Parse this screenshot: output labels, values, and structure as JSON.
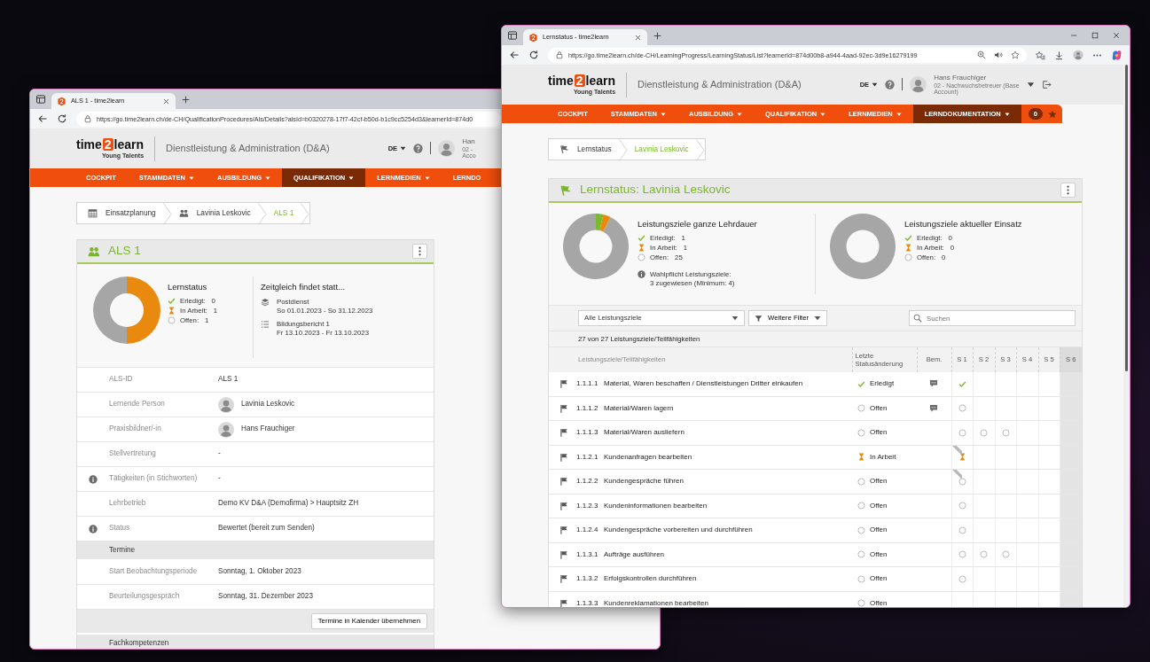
{
  "windows": [
    {
      "kind": "als_details",
      "tab_title": "ALS 1 - time2learn",
      "url": "https://go.time2learn.ch/de-CH/QualificationProcedures/Als/Details?alsId=b0320278-17f7-42cf-b50d-b1c9cc5254d3&learnerId=874d0",
      "window_controls": false,
      "browser_tools": false,
      "scrollbar": false,
      "header": {
        "logo": {
          "part_a": "time",
          "part_b": "2",
          "part_c": "learn",
          "tagline": "Young Talents"
        },
        "title": "Dienstleistung & Administration (D&A)",
        "language": "DE",
        "user_name": "Han",
        "user_role": "02 -\nAcco",
        "user_menu": false
      },
      "nav": [
        {
          "label": "COCKPIT",
          "dropdown": false,
          "selected": false
        },
        {
          "label": "STAMMDATEN",
          "dropdown": true,
          "selected": false
        },
        {
          "label": "AUSBILDUNG",
          "dropdown": true,
          "selected": false
        },
        {
          "label": "QUALIFIKATION",
          "dropdown": true,
          "selected": true
        },
        {
          "label": "LERNMEDIEN",
          "dropdown": true,
          "selected": false
        },
        {
          "label": "LERNDO",
          "dropdown": false,
          "selected": false
        }
      ],
      "breadcrumb": [
        {
          "label": "Einsatzplanung",
          "kind": "calendar",
          "current": false
        },
        {
          "label": "Lavinia Leskovic",
          "kind": "people",
          "current": false
        },
        {
          "label": "ALS 1",
          "kind": "plain",
          "current": true
        }
      ],
      "card": {
        "title": "ALS 1",
        "kind": "people",
        "summary": {
          "legend_title": "Lernstatus",
          "chart_data": {
            "type": "donut",
            "values": [
              0,
              50,
              50
            ]
          },
          "legend": [
            {
              "kind": "done",
              "label": "Erledigt:",
              "count": "0"
            },
            {
              "kind": "progress",
              "label": "In Arbeit:",
              "count": "1"
            },
            {
              "kind": "open",
              "label": "Offen:",
              "count": "1"
            }
          ],
          "side_title": "Zeitgleich findet statt...",
          "events": [
            {
              "kind": "stack",
              "title": "Postdienst",
              "dates": "So 01.01.2023 - So 31.12.2023"
            },
            {
              "kind": "list",
              "title": "Bildungsbericht 1",
              "dates": "Fr 13.10.2023 - Fr 13.10.2023"
            }
          ]
        },
        "details": [
          {
            "kind": "field",
            "label": "ALS-ID",
            "value": "ALS 1",
            "info": false,
            "avatar": false
          },
          {
            "kind": "field",
            "label": "Lernende Person",
            "value": "Lavinia Leskovic",
            "info": false,
            "avatar": true
          },
          {
            "kind": "field",
            "label": "Praxisbildner/-in",
            "value": "Hans Frauchiger",
            "info": false,
            "avatar": true
          },
          {
            "kind": "field",
            "label": "Stellvertretung",
            "value": "-",
            "info": false,
            "avatar": false
          },
          {
            "kind": "field",
            "label": "Tätigkeiten (in Stichworten)",
            "value": "-",
            "info": true,
            "avatar": false
          },
          {
            "kind": "field",
            "label": "Lehrbetrieb",
            "value": "Demo KV D&A (Demofirma) > Hauptsitz ZH",
            "info": false,
            "avatar": false
          },
          {
            "kind": "field",
            "label": "Status",
            "value": "Bewertet (bereit zum Senden)",
            "info": true,
            "avatar": false
          },
          {
            "kind": "section",
            "label": "Termine"
          },
          {
            "kind": "field",
            "label": "Start Beobachtungsperiode",
            "value": "Sonntag, 1. Oktober 2023",
            "info": false,
            "avatar": false
          },
          {
            "kind": "field",
            "label": "Beurteilungsgespräch",
            "value": "Sonntag, 31. Dezember 2023",
            "info": false,
            "avatar": false
          },
          {
            "kind": "actions",
            "label": "Termine in Kalender übernehmen"
          },
          {
            "kind": "section",
            "label": "Fachkompetenzen"
          }
        ]
      }
    },
    {
      "kind": "learning_status",
      "tab_title": "Lernstatus - time2learn",
      "url": "https://go.time2learn.ch/de-CH/LearningProgress/LearningStatus/List?learnerId=874d00b8-a944-4aad-92ec-3d9e16279199",
      "window_controls": true,
      "browser_tools": true,
      "scrollbar": true,
      "header": {
        "logo": {
          "part_a": "time",
          "part_b": "2",
          "part_c": "learn",
          "tagline": "Young Talents"
        },
        "title": "Dienstleistung & Administration (D&A)",
        "language": "DE",
        "user_name": "Hans Frauchiger",
        "user_role": "02 - Nachwuchsbetreuer (Base\nAccount)",
        "user_menu": true
      },
      "nav": [
        {
          "label": "COCKPIT",
          "dropdown": false,
          "selected": false
        },
        {
          "label": "STAMMDATEN",
          "dropdown": true,
          "selected": false
        },
        {
          "label": "AUSBILDUNG",
          "dropdown": true,
          "selected": false
        },
        {
          "label": "QUALIFIKATION",
          "dropdown": true,
          "selected": false
        },
        {
          "label": "LERNMEDIEN",
          "dropdown": true,
          "selected": false
        },
        {
          "label": "LERNDOKUMENTATION",
          "dropdown": true,
          "selected": true
        }
      ],
      "nav_extras": {
        "count": "0",
        "star": true
      },
      "breadcrumb": [
        {
          "label": "Lernstatus",
          "kind": "learning",
          "current": false
        },
        {
          "label": "Lavinia Leskovic",
          "kind": "plain",
          "current": true
        }
      ],
      "card": {
        "title": "Lernstatus: Lavinia Leskovic",
        "kind": "learning",
        "summaries": [
          {
            "title": "Leistungsziele ganze Lehrdauer",
            "chart_data": {
              "type": "donut",
              "values": [
                3.7,
                3.7,
                92.6
              ]
            },
            "legend": [
              {
                "kind": "done",
                "label": "Erledigt:",
                "count": "1"
              },
              {
                "kind": "progress",
                "label": "In Arbeit:",
                "count": "1"
              },
              {
                "kind": "open",
                "label": "Offen:",
                "count": "25"
              }
            ],
            "note": "Wahlpflicht Leistungsziele:\n3 zugewiesen (Minimum: 4)"
          },
          {
            "title": "Leistungsziele aktueller Einsatz",
            "legend": [
              {
                "kind": "done",
                "label": "Erledigt:",
                "count": "0"
              },
              {
                "kind": "progress",
                "label": "In Arbeit:",
                "count": "0"
              },
              {
                "kind": "open",
                "label": "Offen:",
                "count": "0"
              }
            ]
          }
        ],
        "filter": {
          "select": "Alle Leistungsziele",
          "button": "Weitere Filter",
          "search_placeholder": "Suchen"
        },
        "count": "27 von 27 Leistungsziele/Teilfähigkeiten",
        "table": {
          "columns": [
            {
              "label": "Leistungsziele/Teilfähigkeiten",
              "kind": "goal"
            },
            {
              "label": "Letzte Statusänderung",
              "kind": "status"
            },
            {
              "label": "Bem.",
              "kind": "remark"
            },
            {
              "label": "S 1",
              "kind": "semester",
              "current": false
            },
            {
              "label": "S 2",
              "kind": "semester",
              "current": false
            },
            {
              "label": "S 3",
              "kind": "semester",
              "current": false
            },
            {
              "label": "S 4",
              "kind": "semester",
              "current": false
            },
            {
              "label": "S 5",
              "kind": "semester",
              "current": false
            },
            {
              "label": "S 6",
              "kind": "semester",
              "current": true
            }
          ],
          "rows": [
            {
              "number": "1.1.1.1",
              "title": "Material, Waren beschaffen / Dienstleistungen Dritter einkaufen",
              "kind": "done",
              "status_label": "Erledigt",
              "remark": true,
              "als_tag": false,
              "semesters": [
                {
                  "kind": "done"
                },
                {
                  "kind": "none"
                },
                {
                  "kind": "none"
                },
                {
                  "kind": "none"
                },
                {
                  "kind": "none"
                },
                {
                  "kind": "none"
                }
              ]
            },
            {
              "number": "1.1.1.2",
              "title": "Material/Waren lagern",
              "kind": "open",
              "status_label": "Offen",
              "remark": true,
              "als_tag": false,
              "semesters": [
                {
                  "kind": "open"
                },
                {
                  "kind": "none"
                },
                {
                  "kind": "none"
                },
                {
                  "kind": "none"
                },
                {
                  "kind": "none"
                },
                {
                  "kind": "none"
                }
              ]
            },
            {
              "number": "1.1.1.3",
              "title": "Material/Waren ausliefern",
              "kind": "open",
              "status_label": "Offen",
              "remark": false,
              "als_tag": false,
              "semesters": [
                {
                  "kind": "open"
                },
                {
                  "kind": "open"
                },
                {
                  "kind": "open"
                },
                {
                  "kind": "none"
                },
                {
                  "kind": "none"
                },
                {
                  "kind": "none"
                }
              ]
            },
            {
              "number": "1.1.2.1",
              "title": "Kundenanfragen bearbeiten",
              "kind": "progress",
              "status_label": "In Arbeit",
              "remark": false,
              "als_tag": true,
              "semesters": [
                {
                  "kind": "progress"
                },
                {
                  "kind": "none"
                },
                {
                  "kind": "none"
                },
                {
                  "kind": "none"
                },
                {
                  "kind": "none"
                },
                {
                  "kind": "none"
                }
              ]
            },
            {
              "number": "1.1.2.2",
              "title": "Kundengespräche führen",
              "kind": "open",
              "status_label": "Offen",
              "remark": false,
              "als_tag": true,
              "semesters": [
                {
                  "kind": "open"
                },
                {
                  "kind": "none"
                },
                {
                  "kind": "none"
                },
                {
                  "kind": "none"
                },
                {
                  "kind": "none"
                },
                {
                  "kind": "none"
                }
              ]
            },
            {
              "number": "1.1.2.3",
              "title": "Kundeninformationen bearbeiten",
              "kind": "open",
              "status_label": "Offen",
              "remark": false,
              "als_tag": false,
              "semesters": [
                {
                  "kind": "open"
                },
                {
                  "kind": "none"
                },
                {
                  "kind": "none"
                },
                {
                  "kind": "none"
                },
                {
                  "kind": "none"
                },
                {
                  "kind": "none"
                }
              ]
            },
            {
              "number": "1.1.2.4",
              "title": "Kundengespräche vorbereiten und durchführen",
              "kind": "open",
              "status_label": "Offen",
              "remark": false,
              "als_tag": false,
              "semesters": [
                {
                  "kind": "open"
                },
                {
                  "kind": "none"
                },
                {
                  "kind": "none"
                },
                {
                  "kind": "none"
                },
                {
                  "kind": "none"
                },
                {
                  "kind": "none"
                }
              ]
            },
            {
              "number": "1.1.3.1",
              "title": "Aufträge ausführen",
              "kind": "open",
              "status_label": "Offen",
              "remark": false,
              "als_tag": false,
              "semesters": [
                {
                  "kind": "open"
                },
                {
                  "kind": "open"
                },
                {
                  "kind": "open"
                },
                {
                  "kind": "none"
                },
                {
                  "kind": "none"
                },
                {
                  "kind": "none"
                }
              ]
            },
            {
              "number": "1.1.3.2",
              "title": "Erfolgskontrollen durchführen",
              "kind": "open",
              "status_label": "Offen",
              "remark": false,
              "als_tag": false,
              "semesters": [
                {
                  "kind": "open"
                },
                {
                  "kind": "none"
                },
                {
                  "kind": "none"
                },
                {
                  "kind": "none"
                },
                {
                  "kind": "none"
                },
                {
                  "kind": "none"
                }
              ]
            },
            {
              "number": "1.1.3.3",
              "title": "Kundenreklamationen bearbeiten",
              "kind": "open",
              "status_label": "Offen",
              "remark": false,
              "als_tag": false,
              "semesters": [
                {
                  "kind": "none"
                },
                {
                  "kind": "none"
                },
                {
                  "kind": "none"
                },
                {
                  "kind": "none"
                },
                {
                  "kind": "none"
                },
                {
                  "kind": "none"
                }
              ]
            }
          ]
        }
      }
    }
  ]
}
